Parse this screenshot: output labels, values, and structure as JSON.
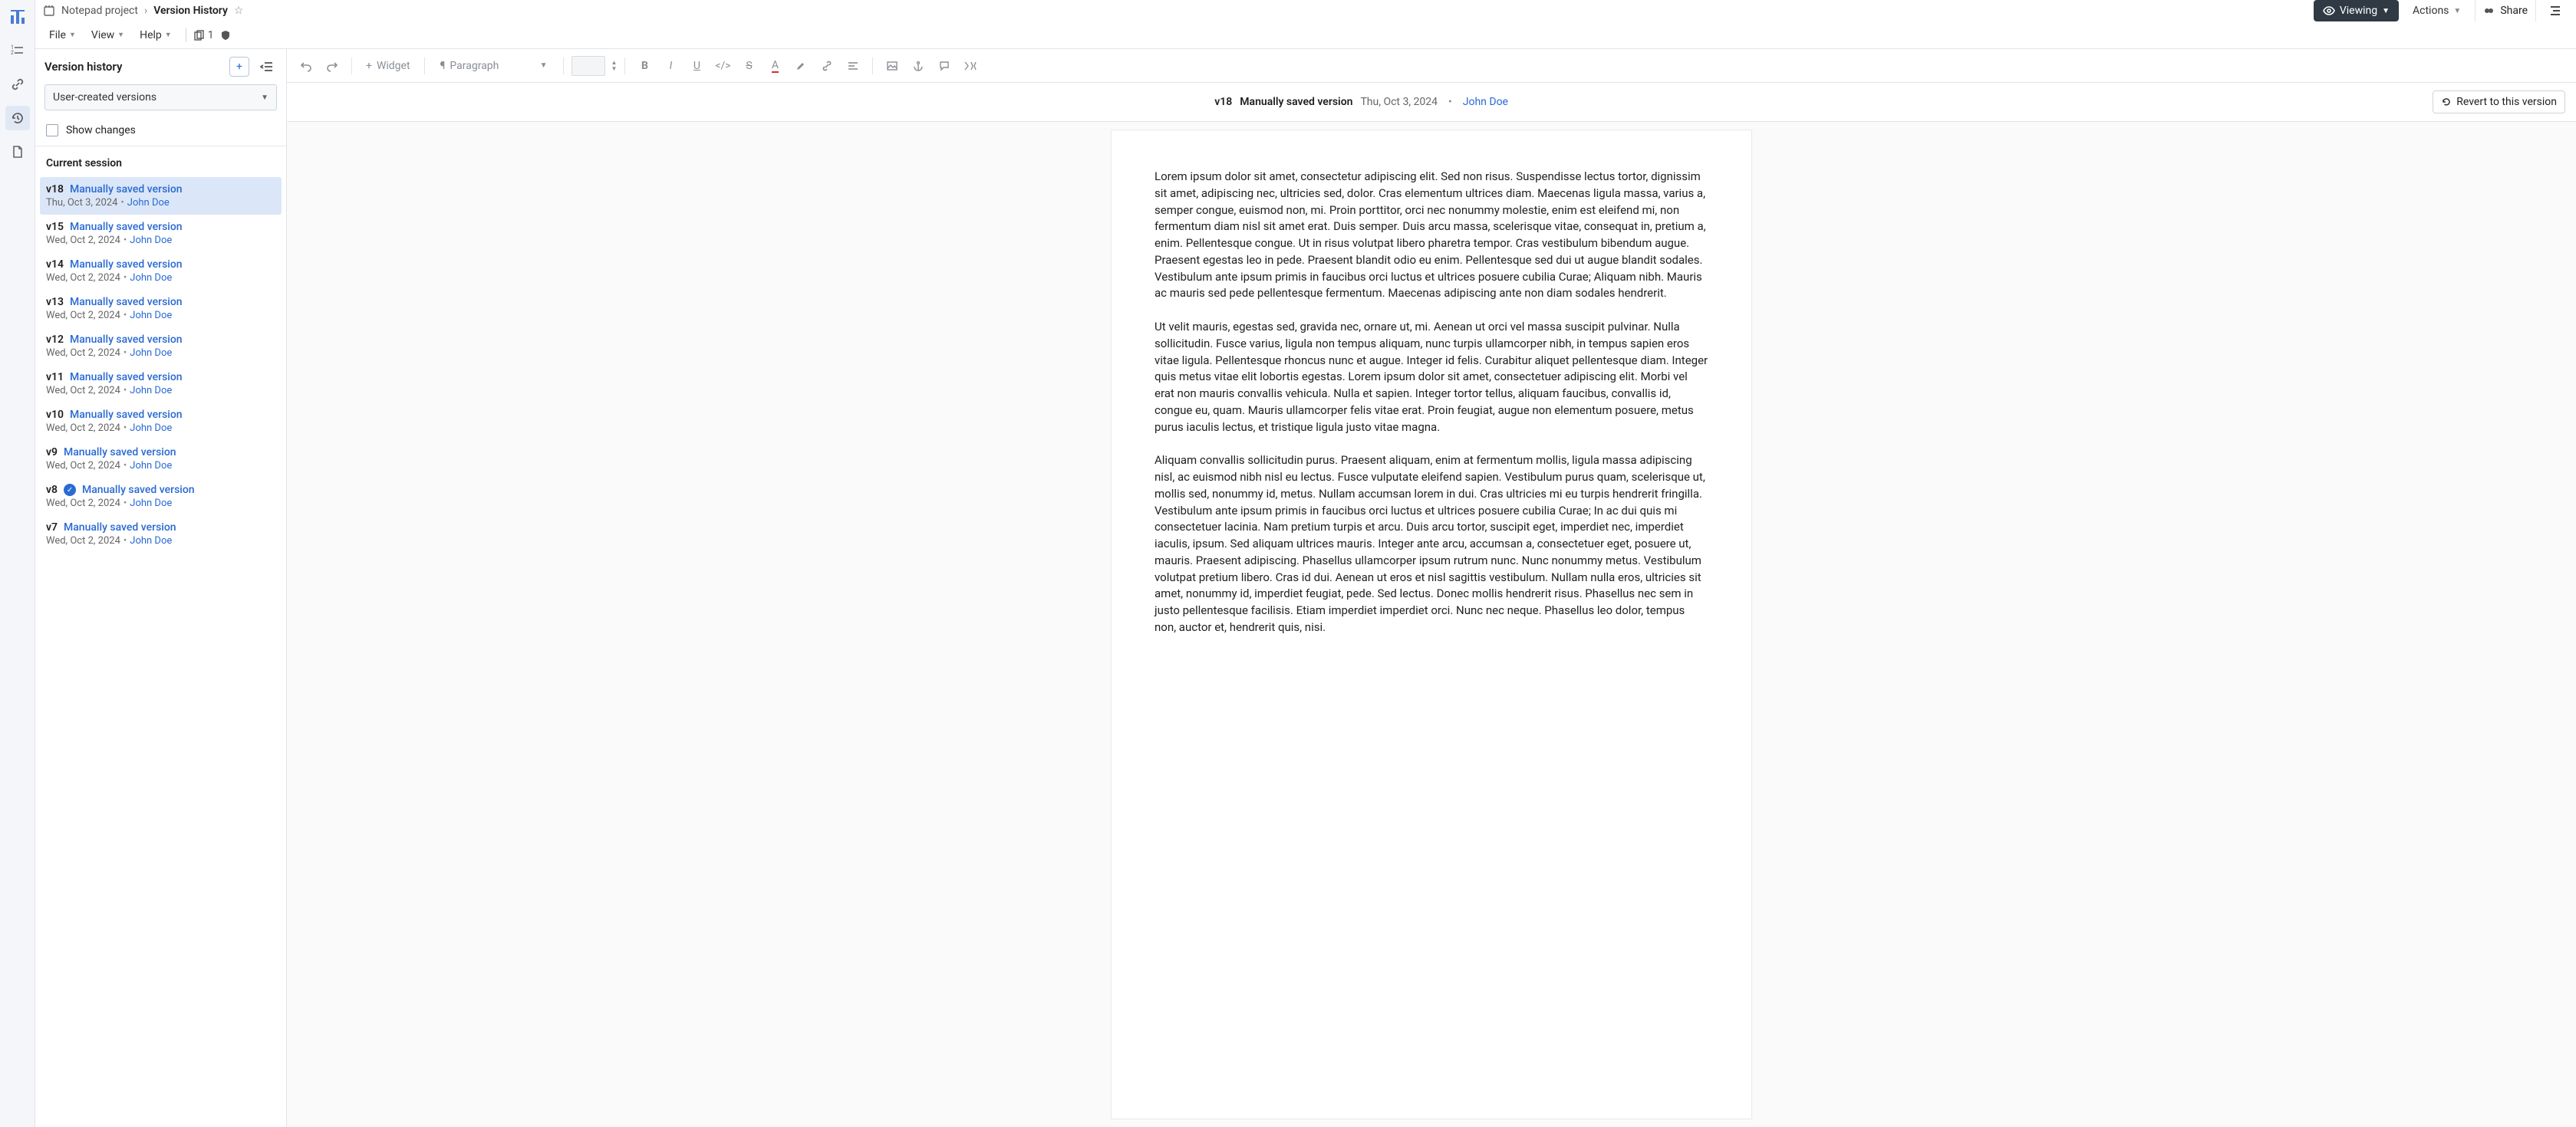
{
  "breadcrumb": {
    "project": "Notepad project",
    "title": "Version History"
  },
  "topbar": {
    "viewing": "Viewing",
    "actions": "Actions",
    "share": "Share"
  },
  "menus": {
    "file": "File",
    "view": "View",
    "help": "Help",
    "copies": "1"
  },
  "sidebar": {
    "title": "Version history",
    "filter": "User-created versions",
    "show_changes": "Show changes",
    "session": "Current session",
    "versions": [
      {
        "num": "v18",
        "title": "Manually saved version",
        "date": "Thu, Oct 3, 2024",
        "author": "John Doe",
        "selected": true,
        "badge": false
      },
      {
        "num": "v15",
        "title": "Manually saved version",
        "date": "Wed, Oct 2, 2024",
        "author": "John Doe",
        "selected": false,
        "badge": false
      },
      {
        "num": "v14",
        "title": "Manually saved version",
        "date": "Wed, Oct 2, 2024",
        "author": "John Doe",
        "selected": false,
        "badge": false
      },
      {
        "num": "v13",
        "title": "Manually saved version",
        "date": "Wed, Oct 2, 2024",
        "author": "John Doe",
        "selected": false,
        "badge": false
      },
      {
        "num": "v12",
        "title": "Manually saved version",
        "date": "Wed, Oct 2, 2024",
        "author": "John Doe",
        "selected": false,
        "badge": false
      },
      {
        "num": "v11",
        "title": "Manually saved version",
        "date": "Wed, Oct 2, 2024",
        "author": "John Doe",
        "selected": false,
        "badge": false
      },
      {
        "num": "v10",
        "title": "Manually saved version",
        "date": "Wed, Oct 2, 2024",
        "author": "John Doe",
        "selected": false,
        "badge": false
      },
      {
        "num": "v9",
        "title": "Manually saved version",
        "date": "Wed, Oct 2, 2024",
        "author": "John Doe",
        "selected": false,
        "badge": false
      },
      {
        "num": "v8",
        "title": "Manually saved version",
        "date": "Wed, Oct 2, 2024",
        "author": "John Doe",
        "selected": false,
        "badge": true
      },
      {
        "num": "v7",
        "title": "Manually saved version",
        "date": "Wed, Oct 2, 2024",
        "author": "John Doe",
        "selected": false,
        "badge": false
      }
    ]
  },
  "toolbar": {
    "widget": "Widget",
    "paragraph": "Paragraph"
  },
  "banner": {
    "num": "v18",
    "title": "Manually saved version",
    "date": "Thu, Oct 3, 2024",
    "author": "John Doe",
    "revert": "Revert to this version"
  },
  "doc": {
    "p1": "Lorem ipsum dolor sit amet, consectetur adipiscing elit. Sed non risus. Suspendisse lectus tortor, dignissim sit amet, adipiscing nec, ultricies sed, dolor. Cras elementum ultrices diam. Maecenas ligula massa, varius a, semper congue, euismod non, mi. Proin porttitor, orci nec nonummy molestie, enim est eleifend mi, non fermentum diam nisl sit amet erat. Duis semper. Duis arcu massa, scelerisque vitae, consequat in, pretium a, enim. Pellentesque congue. Ut in risus volutpat libero pharetra tempor. Cras vestibulum bibendum augue. Praesent egestas leo in pede. Praesent blandit odio eu enim. Pellentesque sed dui ut augue blandit sodales. Vestibulum ante ipsum primis in faucibus orci luctus et ultrices posuere cubilia Curae; Aliquam nibh. Mauris ac mauris sed pede pellentesque fermentum. Maecenas adipiscing ante non diam sodales hendrerit.",
    "p2": "Ut velit mauris, egestas sed, gravida nec, ornare ut, mi. Aenean ut orci vel massa suscipit pulvinar. Nulla sollicitudin. Fusce varius, ligula non tempus aliquam, nunc turpis ullamcorper nibh, in tempus sapien eros vitae ligula. Pellentesque rhoncus nunc et augue. Integer id felis. Curabitur aliquet pellentesque diam. Integer quis metus vitae elit lobortis egestas. Lorem ipsum dolor sit amet, consectetuer adipiscing elit. Morbi vel erat non mauris convallis vehicula. Nulla et sapien. Integer tortor tellus, aliquam faucibus, convallis id, congue eu, quam. Mauris ullamcorper felis vitae erat. Proin feugiat, augue non elementum posuere, metus purus iaculis lectus, et tristique ligula justo vitae magna.",
    "p3": "Aliquam convallis sollicitudin purus. Praesent aliquam, enim at fermentum mollis, ligula massa adipiscing nisl, ac euismod nibh nisl eu lectus. Fusce vulputate eleifend sapien. Vestibulum purus quam, scelerisque ut, mollis sed, nonummy id, metus. Nullam accumsan lorem in dui. Cras ultricies mi eu turpis hendrerit fringilla. Vestibulum ante ipsum primis in faucibus orci luctus et ultrices posuere cubilia Curae; In ac dui quis mi consectetuer lacinia. Nam pretium turpis et arcu. Duis arcu tortor, suscipit eget, imperdiet nec, imperdiet iaculis, ipsum. Sed aliquam ultrices mauris. Integer ante arcu, accumsan a, consectetuer eget, posuere ut, mauris. Praesent adipiscing. Phasellus ullamcorper ipsum rutrum nunc. Nunc nonummy metus. Vestibulum volutpat pretium libero. Cras id dui. Aenean ut eros et nisl sagittis vestibulum. Nullam nulla eros, ultricies sit amet, nonummy id, imperdiet feugiat, pede. Sed lectus. Donec mollis hendrerit risus. Phasellus nec sem in justo pellentesque facilisis. Etiam imperdiet imperdiet orci. Nunc nec neque. Phasellus leo dolor, tempus non, auctor et, hendrerit quis, nisi."
  }
}
